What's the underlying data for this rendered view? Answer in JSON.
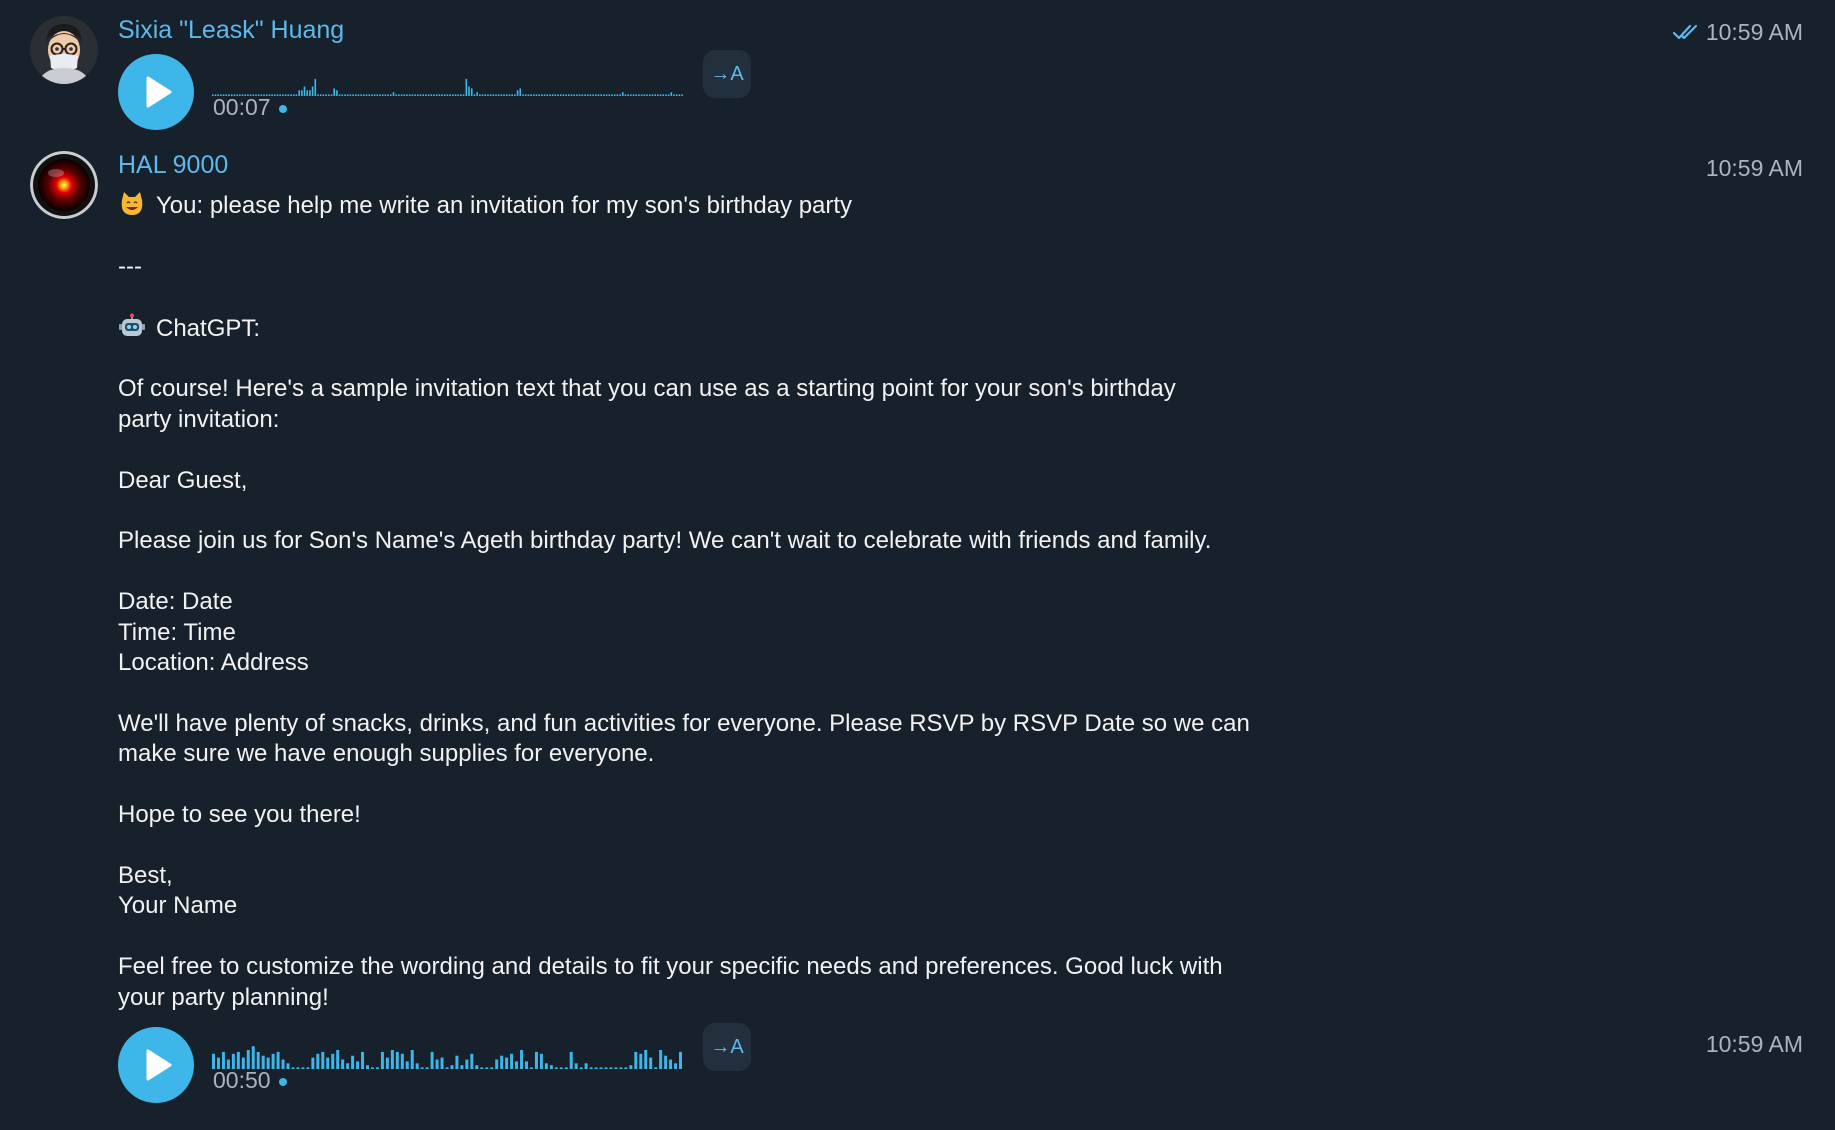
{
  "messages": [
    {
      "sender": "Sixia \"Leask\" Huang",
      "time": "10:59 AM",
      "read_status": "double-check-icon",
      "voice": {
        "duration": "00:07",
        "transcribe_label": "→A",
        "play_icon": "play-icon"
      }
    },
    {
      "sender": "HAL 9000",
      "time": "10:59 AM",
      "lines": [
        {
          "emoji": "cat-emoji",
          "text": "You: please help me write an invitation for my son's birthday party"
        },
        {
          "text": ""
        },
        {
          "text": "---"
        },
        {
          "text": ""
        },
        {
          "emoji": "robot-emoji",
          "text": "ChatGPT:"
        },
        {
          "text": ""
        },
        {
          "text": "Of course! Here's a sample invitation text that you can use as a starting point for your son's birthday"
        },
        {
          "text": "party invitation:"
        },
        {
          "text": ""
        },
        {
          "text": "Dear Guest,"
        },
        {
          "text": ""
        },
        {
          "text": "Please join us for Son's Name's Ageth birthday party! We can't wait to celebrate with friends and family."
        },
        {
          "text": ""
        },
        {
          "text": "Date: Date"
        },
        {
          "text": "Time: Time"
        },
        {
          "text": "Location: Address"
        },
        {
          "text": ""
        },
        {
          "text": "We'll have plenty of snacks, drinks, and fun activities for everyone. Please RSVP by RSVP Date so we can"
        },
        {
          "text": "make sure we have enough supplies for everyone."
        },
        {
          "text": ""
        },
        {
          "text": "Hope to see you there!"
        },
        {
          "text": ""
        },
        {
          "text": "Best,"
        },
        {
          "text": "Your Name"
        },
        {
          "text": ""
        },
        {
          "text": "Feel free to customize the wording and details to fit your specific needs and preferences. Good luck with"
        },
        {
          "text": "your party planning!"
        }
      ]
    },
    {
      "time": "10:59 AM",
      "voice": {
        "duration": "00:50",
        "transcribe_label": "→A",
        "play_icon": "play-icon"
      }
    }
  ],
  "colors": {
    "background": "#17212b",
    "accent": "#3fb6ea",
    "sender_name": "#5fb8ec",
    "timestamp": "#aab4bf",
    "text": "#f2f2f2"
  }
}
